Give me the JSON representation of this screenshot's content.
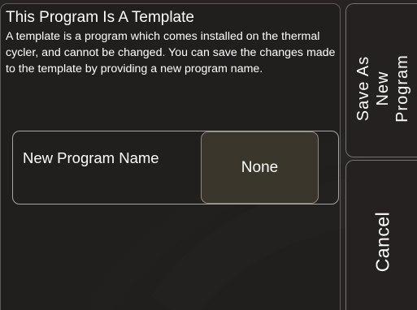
{
  "dialog": {
    "title": "This Program Is A Template",
    "description": "A template is a program which comes installed on the thermal cycler, and cannot be changed. You can save the changes made to the template by providing a new program name.",
    "new_program_name_label": "New Program Name",
    "new_program_name_value": "None"
  },
  "actions": {
    "save_as_new_program": "Save As New Program",
    "cancel": "Cancel"
  },
  "colors": {
    "background": "#262322",
    "value_field": "#3b362c",
    "border": "#a9a5a1",
    "text": "#ffffff"
  }
}
